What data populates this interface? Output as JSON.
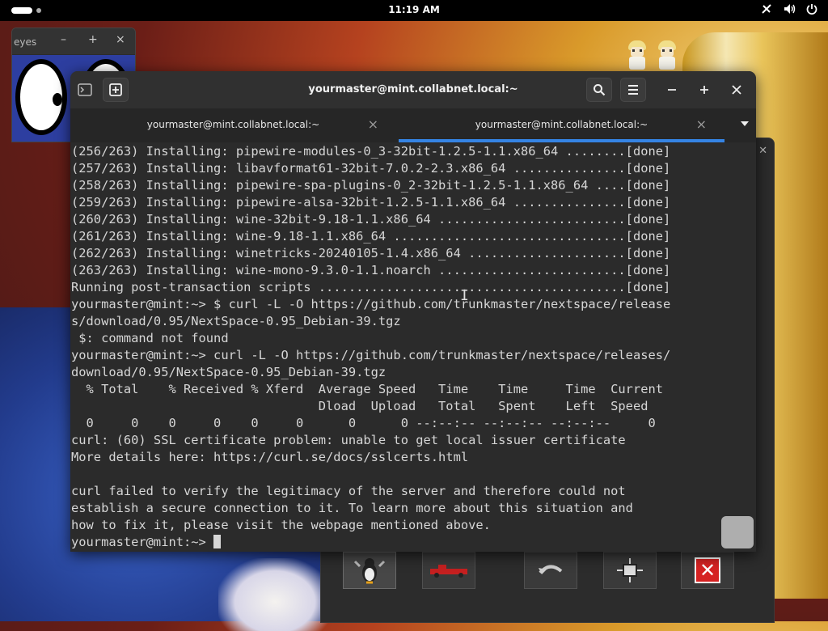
{
  "top_panel": {
    "clock": "11:19 AM",
    "tray_icons": [
      "network-icon",
      "volume-icon",
      "power-icon"
    ]
  },
  "xeyes_window": {
    "title": "eyes",
    "buttons": [
      "–",
      "+",
      "×"
    ]
  },
  "terminal": {
    "title": "yourmaster@mint.collabnet.local:~",
    "tabs": [
      {
        "label": "yourmaster@mint.collabnet.local:~",
        "active": false
      },
      {
        "label": "yourmaster@mint.collabnet.local:~",
        "active": true
      }
    ],
    "lines": [
      "(256/263) Installing: pipewire-modules-0_3-32bit-1.2.5-1.1.x86_64 ........[done]",
      "(257/263) Installing: libavformat61-32bit-7.0.2-2.3.x86_64 ...............[done]",
      "(258/263) Installing: pipewire-spa-plugins-0_2-32bit-1.2.5-1.1.x86_64 ....[done]",
      "(259/263) Installing: pipewire-alsa-32bit-1.2.5-1.1.x86_64 ...............[done]",
      "(260/263) Installing: wine-32bit-9.18-1.1.x86_64 .........................[done]",
      "(261/263) Installing: wine-9.18-1.1.x86_64 ...............................[done]",
      "(262/263) Installing: winetricks-20240105-1.4.x86_64 .....................[done]",
      "(263/263) Installing: wine-mono-9.3.0-1.1.noarch .........................[done]",
      "Running post-transaction scripts .........................................[done]",
      "yourmaster@mint:~> $ curl -L -O https://github.com/trunkmaster/nextspace/release",
      "s/download/0.95/NextSpace-0.95_Debian-39.tgz",
      " $: command not found",
      "yourmaster@mint:~> curl -L -O https://github.com/trunkmaster/nextspace/releases/",
      "download/0.95/NextSpace-0.95_Debian-39.tgz",
      "  % Total    % Received % Xferd  Average Speed   Time    Time     Time  Current",
      "                                 Dload  Upload   Total   Spent    Left  Speed",
      "  0     0    0     0    0     0      0      0 --:--:-- --:--:-- --:--:--     0",
      "curl: (60) SSL certificate problem: unable to get local issuer certificate",
      "More details here: https://curl.se/docs/sslcerts.html",
      "",
      "curl failed to verify the legitimacy of the server and therefore could not",
      "establish a secure connection to it. To learn more about this situation and",
      "how to fix it, please visit the webpage mentioned above."
    ],
    "prompt": "yourmaster@mint:~> "
  },
  "colors": {
    "tab_underline": "#3584e4",
    "close_red": "#d62222"
  }
}
